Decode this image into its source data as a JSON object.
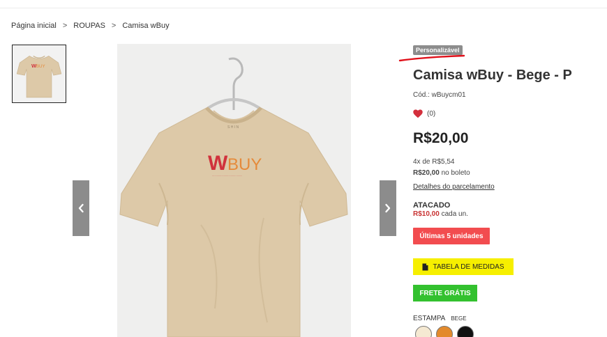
{
  "breadcrumb": {
    "items": [
      "Página inicial",
      "ROUPAS",
      "Camisa wBuy"
    ],
    "separator": ">"
  },
  "gallery": {
    "thumbnail_alt": "Camisa wBuy",
    "brand_mark": "WBUY",
    "prev_icon": "chevron-left-icon",
    "next_icon": "chevron-right-icon"
  },
  "product": {
    "badge": "Personalizável",
    "title": "Camisa wBuy - Bege - P",
    "sku": "Cód.: wBuycm01",
    "wishlist_count": "(0)",
    "price": "R$20,00",
    "installments": "4x de R$5,54",
    "boleto_price": "R$20,00",
    "boleto_label": "no boleto",
    "details_link": "Detalhes do parcelamento",
    "wholesale_heading": "ATACADO",
    "wholesale_price": "R$10,00",
    "wholesale_unit": "cada un.",
    "stock_button": "Últimas 5 unidades",
    "size_table_button": "TABELA DE MEDIDAS",
    "free_shipping_button": "FRETE GRÁTIS",
    "print_label": "ESTAMPA",
    "print_value": "BEGE",
    "swatches": [
      "#f5e9d2",
      "#e38a2c",
      "#111111"
    ]
  },
  "colors": {
    "badge": "#8d8d8d",
    "stock": "#f24c4f",
    "size_table": "#f6ef00",
    "free_shipping": "#33c12f",
    "heart": "#d32f3c",
    "shirt": "#ddc9a8",
    "logo_red": "#d0323c"
  }
}
